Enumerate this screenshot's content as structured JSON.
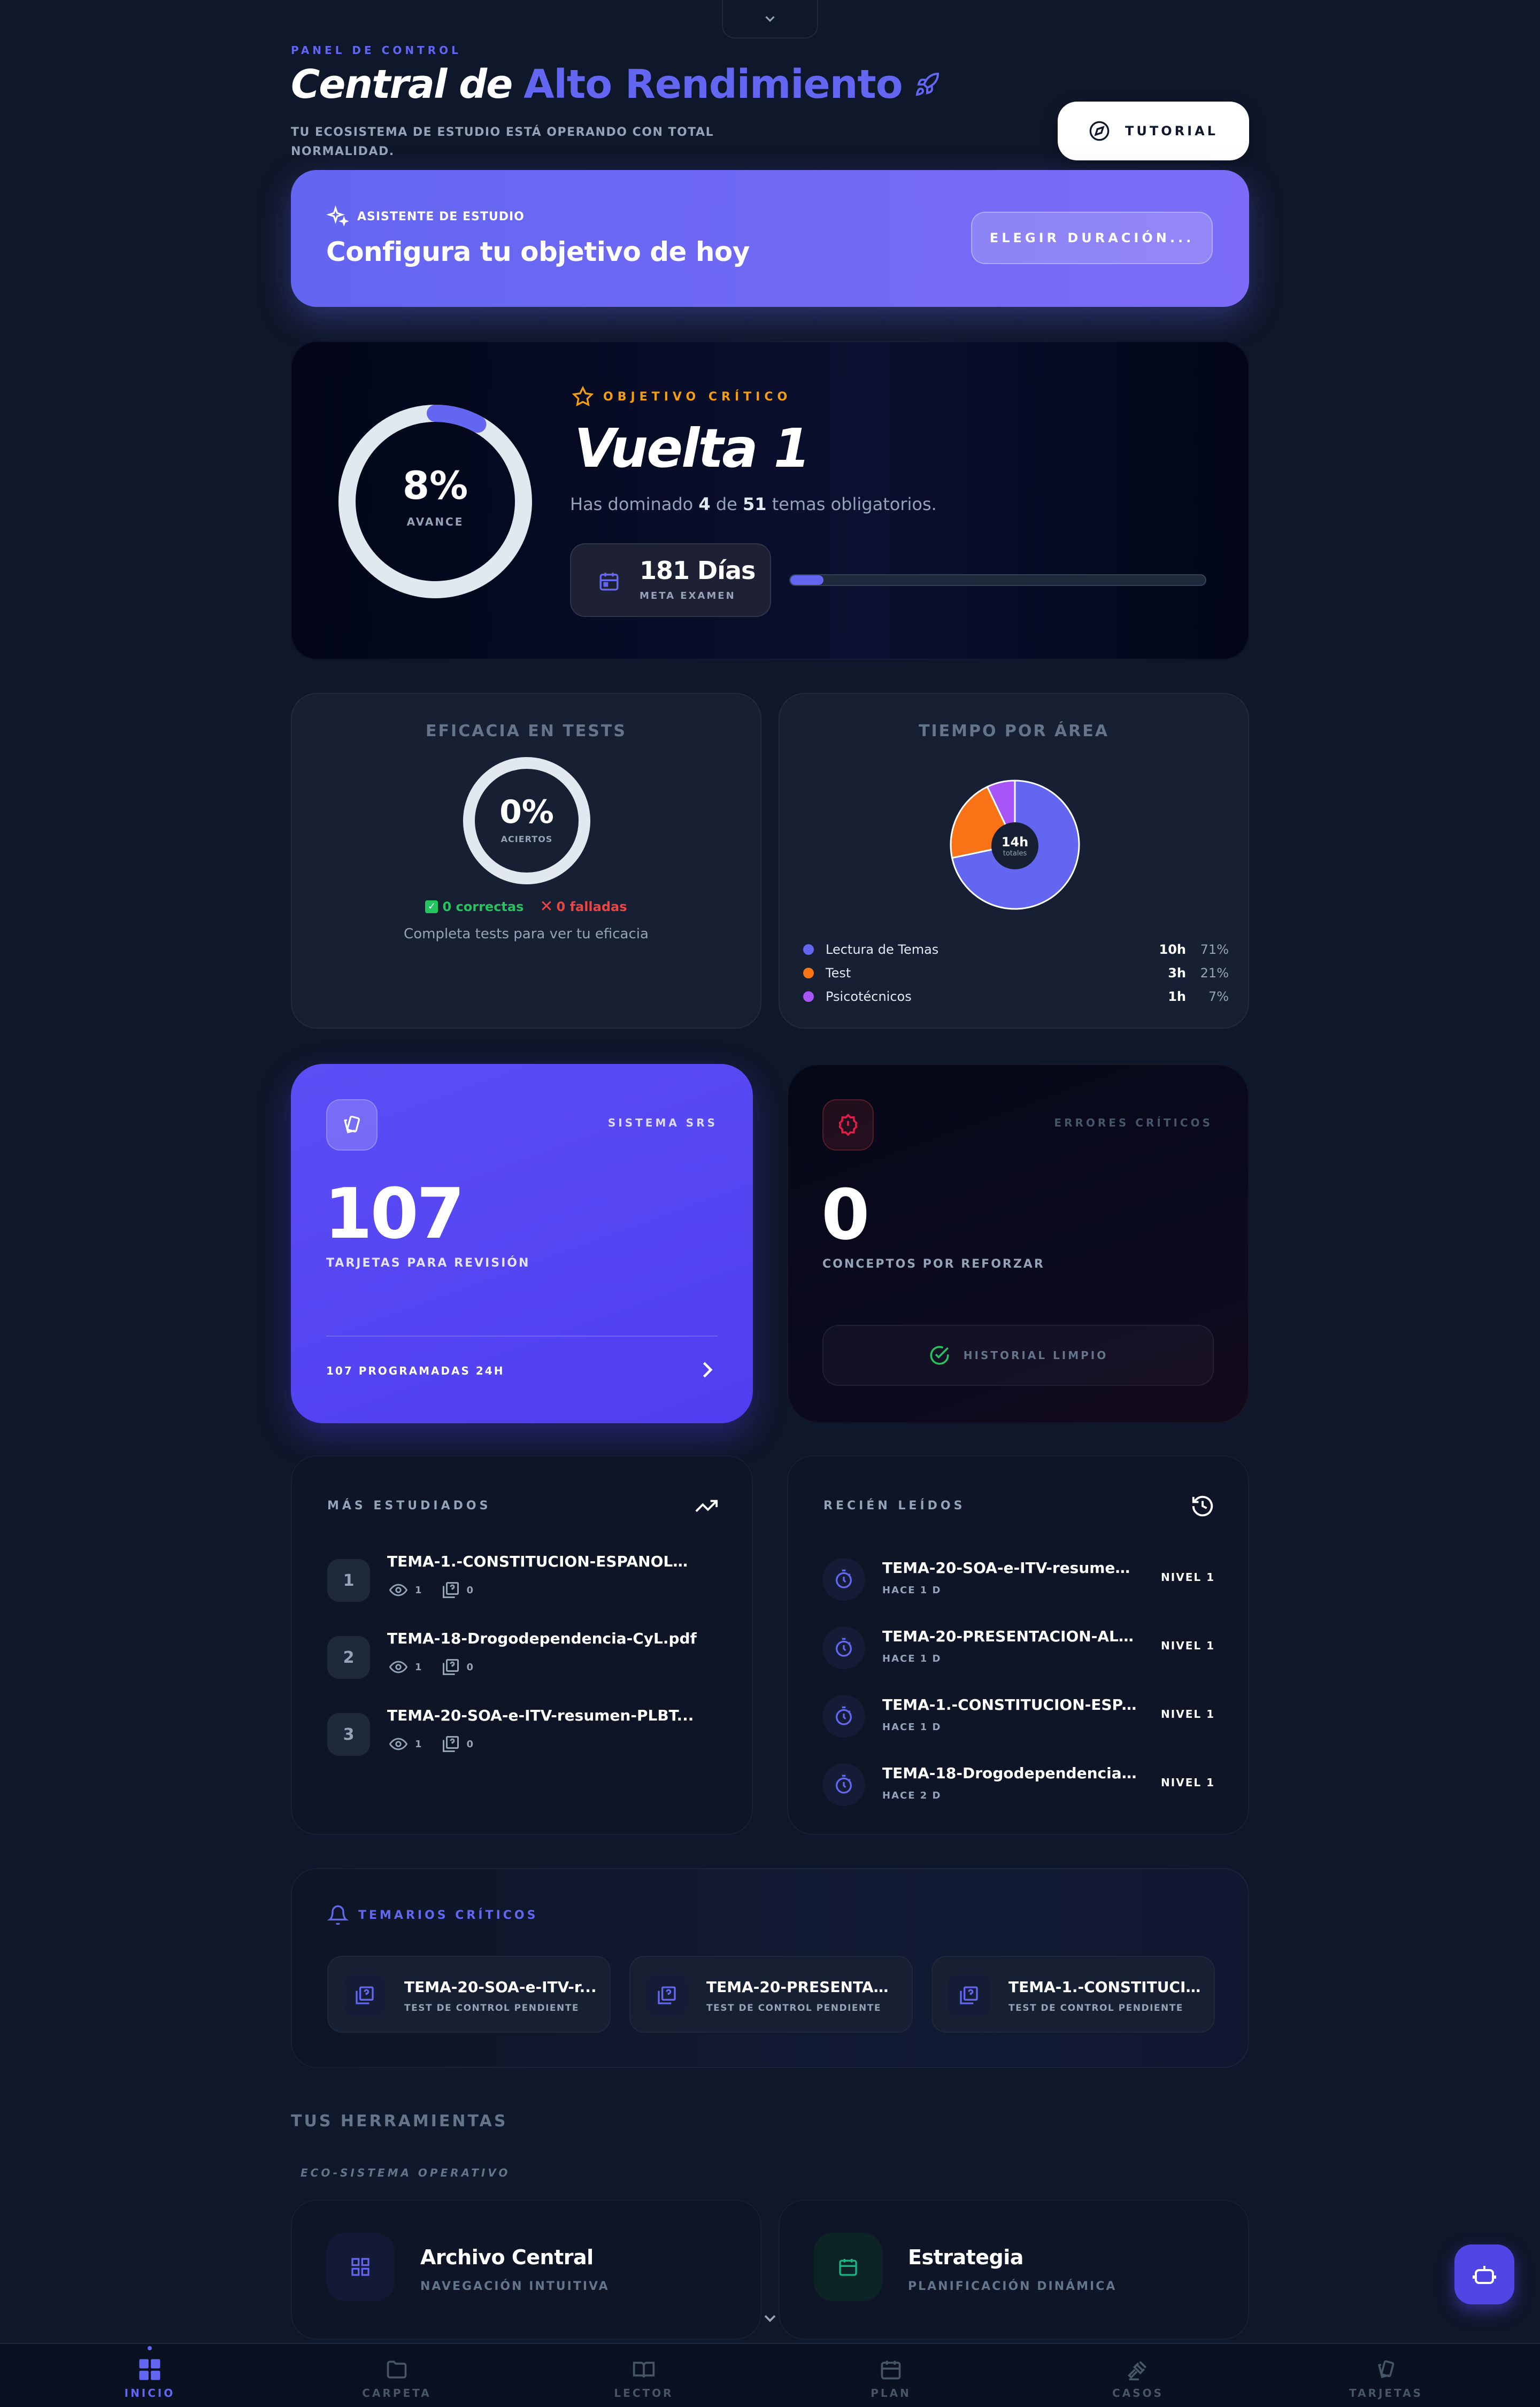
{
  "header": {
    "eyebrow": "PANEL DE CONTROL",
    "title_part1": "Central de",
    "title_part2": "Alto Rendimiento",
    "subtitle_line1": "TU ECOSISTEMA DE ESTUDIO ESTÁ OPERANDO CON TOTAL",
    "subtitle_line2": "NORMALIDAD.",
    "tutorial_label": "TUTORIAL"
  },
  "assistant": {
    "label": "ASISTENTE DE ESTUDIO",
    "title": "Configura tu objetivo de hoy",
    "button": "ELEGIR DURACIÓN..."
  },
  "objective": {
    "progress_value": "8%",
    "progress_fraction": 0.08,
    "progress_label": "AVANCE",
    "tag": "OBJETIVO CRÍTICO",
    "title": "Vuelta 1",
    "desc_prefix": "Has dominado",
    "mastered": "4",
    "desc_mid": "de",
    "total": "51",
    "desc_suffix": "temas obligatorios.",
    "days": "181 Días",
    "days_label": "META EXAMEN",
    "bar_fraction": 0.08
  },
  "tests": {
    "title": "EFICACIA EN TESTS",
    "value": "0%",
    "value_label": "ACIERTOS",
    "correct": "0 correctas",
    "failed": "0 falladas",
    "hint": "Completa tests para ver tu eficacia"
  },
  "time_area": {
    "title": "TIEMPO POR ÁREA",
    "center_value": "14h",
    "center_label": "totales",
    "items": [
      {
        "label": "Lectura de Temas",
        "hours": "10h",
        "pct": "71%",
        "color": "#6366f1"
      },
      {
        "label": "Test",
        "hours": "3h",
        "pct": "21%",
        "color": "#f97316"
      },
      {
        "label": "Psicotécnicos",
        "hours": "1h",
        "pct": "7%",
        "color": "#a855f7"
      }
    ]
  },
  "chart_data": {
    "type": "pie",
    "categories": [
      "Lectura de Temas",
      "Test",
      "Psicotécnicos"
    ],
    "values": [
      71,
      21,
      7
    ],
    "colors": [
      "#6366f1",
      "#f97316",
      "#a855f7"
    ],
    "title": "TIEMPO POR ÁREA"
  },
  "srs": {
    "label": "SISTEMA SRS",
    "value": "107",
    "desc": "TARJETAS PARA REVISIÓN",
    "footer": "107 PROGRAMADAS 24H"
  },
  "errors": {
    "label": "ERRORES CRÍTICOS",
    "value": "0",
    "desc": "CONCEPTOS POR REFORZAR",
    "status": "HISTORIAL LIMPIO"
  },
  "most_studied": {
    "title": "MÁS ESTUDIADOS",
    "items": [
      {
        "rank": "1",
        "name": "TEMA-1.-CONSTITUCION-ESPANOLA...",
        "views": "1",
        "tests": "0"
      },
      {
        "rank": "2",
        "name": "TEMA-18-Drogodependencia-CyL.pdf",
        "views": "1",
        "tests": "0"
      },
      {
        "rank": "3",
        "name": "TEMA-20-SOA-e-ITV-resumen-PLBT...",
        "views": "1",
        "tests": "0"
      }
    ]
  },
  "recent": {
    "title": "RECIÉN LEÍDOS",
    "items": [
      {
        "name": "TEMA-20-SOA-e-ITV-resumen-P...",
        "ago": "HACE 1 D",
        "level": "NIVEL 1"
      },
      {
        "name": "TEMA-20-PRESENTACION-ALCO...",
        "ago": "HACE 1 D",
        "level": "NIVEL 1"
      },
      {
        "name": "TEMA-1.-CONSTITUCION-ESPA...",
        "ago": "HACE 1 D",
        "level": "NIVEL 1"
      },
      {
        "name": "TEMA-18-Drogodependencia-Cy...",
        "ago": "HACE 2 D",
        "level": "NIVEL 1"
      }
    ]
  },
  "critical": {
    "title": "TEMARIOS CRÍTICOS",
    "items": [
      {
        "name": "TEMA-20-SOA-e-ITV-r...",
        "status": "TEST DE CONTROL PENDIENTE"
      },
      {
        "name": "TEMA-20-PRESENTACI...",
        "status": "TEST DE CONTROL PENDIENTE"
      },
      {
        "name": "TEMA-1.-CONSTITUCI...",
        "status": "TEST DE CONTROL PENDIENTE"
      }
    ]
  },
  "tools": {
    "title": "TUS HERRAMIENTAS",
    "subtitle": "ECO-SISTEMA OPERATIVO",
    "items": [
      {
        "name": "Archivo Central",
        "desc": "NAVEGACIÓN INTUITIVA"
      },
      {
        "name": "Estrategia",
        "desc": "PLANIFICACIÓN DINÁMICA"
      }
    ]
  },
  "nav": {
    "items": [
      {
        "label": "INICIO",
        "icon": "grid-icon"
      },
      {
        "label": "CARPETA",
        "icon": "folder-icon"
      },
      {
        "label": "LECTOR",
        "icon": "book-icon"
      },
      {
        "label": "PLAN",
        "icon": "calendar-icon"
      },
      {
        "label": "CASOS",
        "icon": "gavel-icon"
      },
      {
        "label": "TARJETAS",
        "icon": "cards-icon"
      }
    ]
  }
}
